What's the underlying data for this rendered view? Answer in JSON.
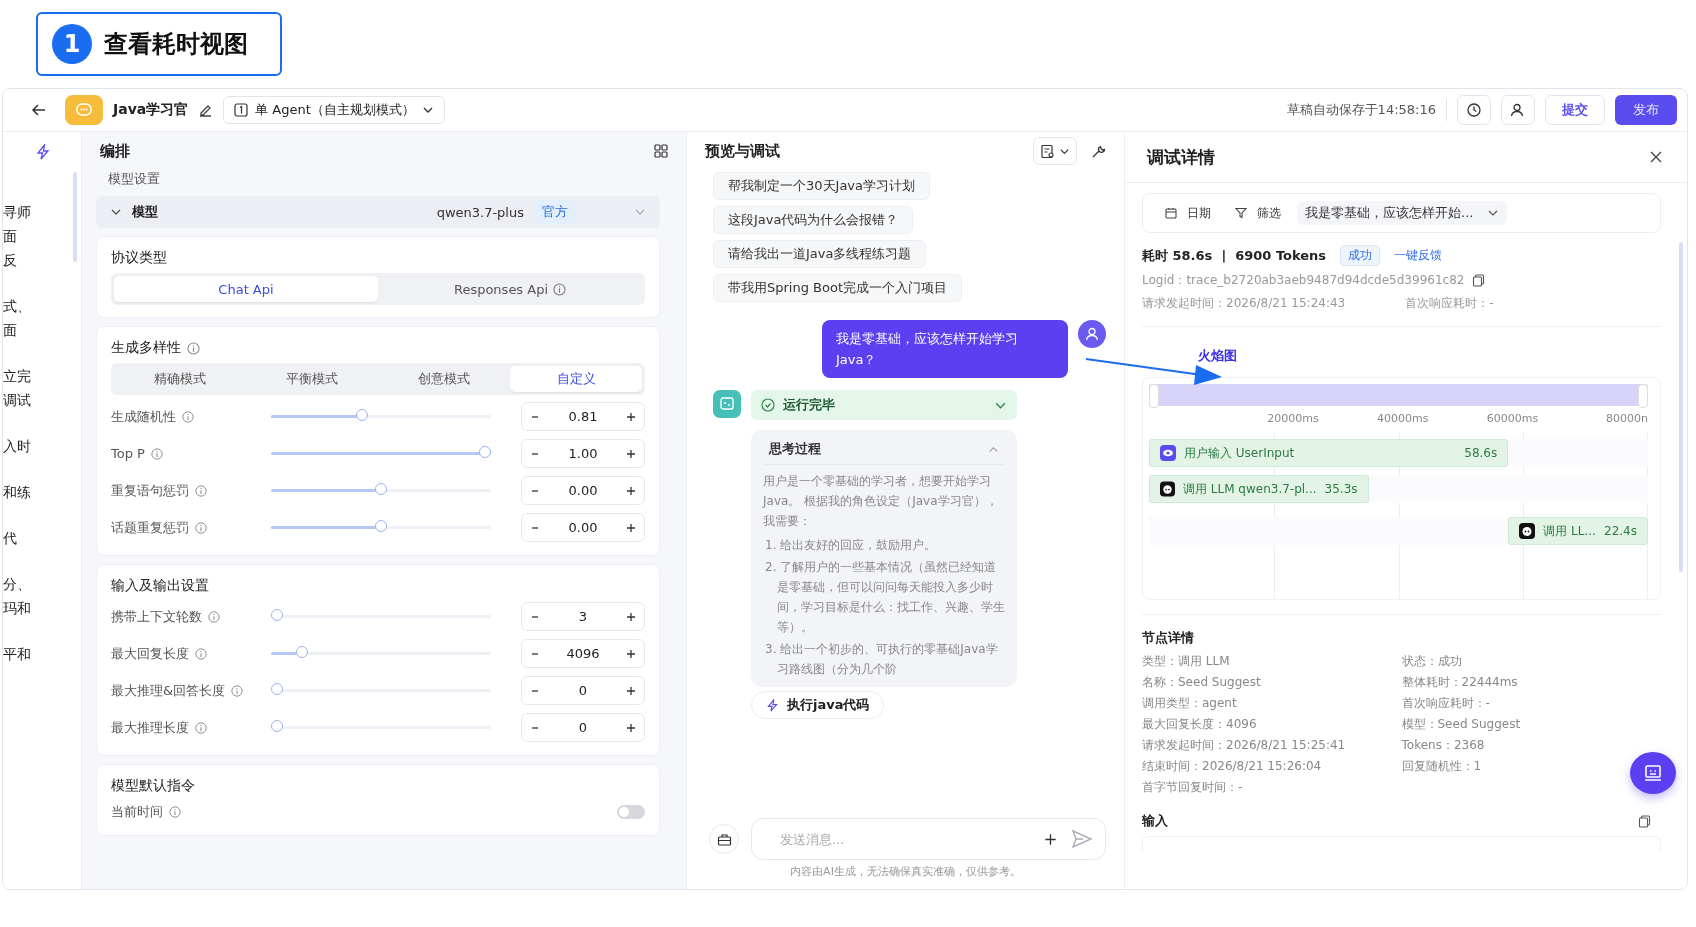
{
  "callout": {
    "number": "1",
    "title": "查看耗时视图"
  },
  "topbar": {
    "agent_name": "Java学习官",
    "mode": "单 Agent（自主规划模式）",
    "autosave": "草稿自动保存于14:58:16",
    "submit": "提交",
    "publish": "发布"
  },
  "side_fragments": [
    [
      "寻师",
      "面",
      "反"
    ],
    [
      "式、",
      "面"
    ],
    [
      "立完",
      "调试"
    ],
    [
      "入时"
    ],
    [
      "和练"
    ],
    [
      "代"
    ],
    [
      "分、",
      "玛和"
    ],
    [
      "平和"
    ]
  ],
  "left_panel": {
    "title": "编排",
    "section": "模型设置",
    "model": {
      "label": "模型",
      "value": "qwen3.7-plus",
      "tag": "官方"
    },
    "protocol": {
      "title": "协议类型",
      "tabs": [
        {
          "label": "Chat Api",
          "selected": true,
          "info": false
        },
        {
          "label": "Responses Api",
          "selected": false,
          "info": true
        }
      ]
    },
    "diversity": {
      "title": "生成多样性",
      "modes": [
        {
          "label": "精确模式",
          "selected": false
        },
        {
          "label": "平衡模式",
          "selected": false
        },
        {
          "label": "创意模式",
          "selected": false
        },
        {
          "label": "自定义",
          "selected": true
        }
      ],
      "sliders": [
        {
          "label": "生成随机性",
          "level": 0.41,
          "value": "0.81"
        },
        {
          "label": "Top P",
          "level": 1,
          "value": "1.00"
        },
        {
          "label": "重复语句惩罚",
          "level": 0.5,
          "value": "0.00"
        },
        {
          "label": "话题重复惩罚",
          "level": 0.5,
          "value": "0.00"
        }
      ]
    },
    "io": {
      "title": "输入及输出设置",
      "sliders": [
        {
          "label": "携带上下文轮数",
          "level": 0,
          "value": "3"
        },
        {
          "label": "最大回复长度",
          "level": 0.12,
          "value": "4096"
        },
        {
          "label": "最大推理&回答长度",
          "level": 0,
          "value": "0"
        },
        {
          "label": "最大推理长度",
          "level": 0,
          "value": "0"
        }
      ]
    },
    "instructions": {
      "title": "模型默认指令",
      "toggle": {
        "label": "当前时间",
        "on": false
      }
    }
  },
  "preview": {
    "title": "预览与调试",
    "suggestions": [
      "帮我制定一个30天Java学习计划",
      "这段Java代码为什么会报错？",
      "请给我出一道Java多线程练习题",
      "带我用Spring Boot完成一个入门项目"
    ],
    "user_message": "我是零基础，应该怎样开始学习Java？",
    "status": "运行完毕",
    "thinking": {
      "title": "思考过程",
      "expanded": true,
      "intro": "用户是一个零基础的学习者，想要开始学习Java。 根据我的角色设定（Java学习官），我需要：",
      "steps": [
        "1. 给出友好的回应，鼓励用户。",
        "2. 了解用户的一些基本情况（虽然已经知道是零基础，但可以问问每天能投入多少时间，学习目标是什么：找工作、兴趣、学生等）。",
        "3. 给出一个初步的、可执行的零基础Java学习路线图（分为几个阶"
      ]
    },
    "action": "执行java代码",
    "input": {
      "placeholder": "发送消息..."
    },
    "disclaimer": "内容由AI生成，无法确保真实准确，仅供参考。"
  },
  "debug": {
    "title": "调试详情",
    "filters": {
      "date": "日期",
      "filter": "筛选",
      "query": "我是零基础，应该怎样开始..."
    },
    "summary": {
      "stats": "耗时 58.6s  |  6900 Tokens",
      "status": "成功",
      "feedback": "一键反馈"
    },
    "logid": "Logid：trace_b2720ab3aeb9487d94dcde5d39961c82",
    "request_time": "请求发起时间：2026/8/21 15:24:43",
    "first_response": "首次响应耗时：-",
    "tab": {
      "label": "火焰图",
      "selected": true
    },
    "range": {
      "level": 1
    },
    "ticks": [
      "20000ms",
      "40000ms",
      "60000ms",
      "80000n"
    ],
    "spans": [
      {
        "kind": "input",
        "label": "用户输入 UserInput",
        "duration": "58.6s",
        "level": 0.72
      },
      {
        "kind": "llm",
        "label": "调用 LLM qwen3.7-pl...",
        "duration": "35.3s",
        "level": 0.44
      },
      {
        "kind": "llm",
        "label": "调用 LL...",
        "duration": "22.4s",
        "level": 0.28
      }
    ],
    "node_title": "节点详情",
    "node_left": [
      "类型：调用 LLM",
      "名称：Seed Suggest",
      "调用类型：agent",
      "最大回复长度：4096",
      "请求发起时间：2026/8/21 15:25:41",
      "结束时间：2026/8/21 15:26:04",
      "首字节回复时间：-"
    ],
    "node_right": [
      "状态：成功",
      "整体耗时：22444ms",
      "首次响应耗时：-",
      "模型：Seed Suggest",
      "Tokens：2368",
      "回复随机性：1"
    ],
    "input_title": "输入"
  }
}
